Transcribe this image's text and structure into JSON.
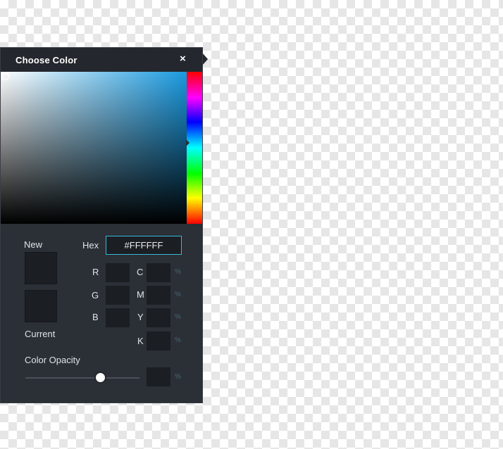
{
  "dialog": {
    "title": "Choose Color",
    "close_glyph": "×"
  },
  "picker": {
    "base_hue_color": "#1a9ae0"
  },
  "preview": {
    "new_label": "New",
    "current_label": "Current"
  },
  "hex": {
    "label": "Hex",
    "value": "#FFFFFF"
  },
  "rgb": {
    "r_label": "R",
    "g_label": "G",
    "b_label": "B"
  },
  "cmyk": {
    "c_label": "C",
    "m_label": "M",
    "y_label": "Y",
    "k_label": "K",
    "unit": "%"
  },
  "opacity": {
    "label": "Color Opacity",
    "unit": "%"
  }
}
